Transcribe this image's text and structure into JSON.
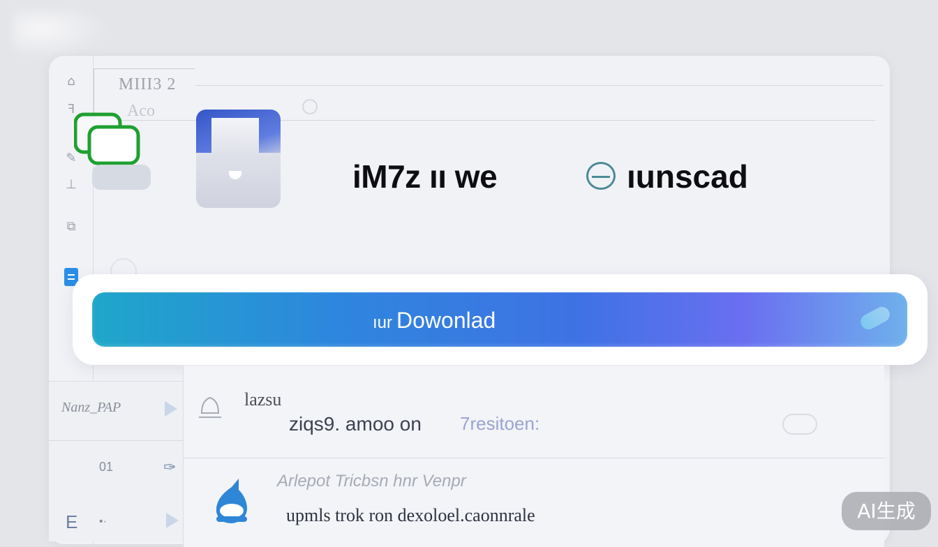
{
  "header": {
    "title": "MIII3 2",
    "subtitle": "Aco"
  },
  "apps": {
    "green_icon": "copy-windows-icon",
    "folder_icon": "folder-app-icon"
  },
  "headline": {
    "left": "iM7z ıı we",
    "right": "ıunscad"
  },
  "download_button": {
    "prefix": "ıur",
    "label": "Dowonlad"
  },
  "sidebar_list": {
    "item1": "Nanz_PAP",
    "item2": "01",
    "item3": "E"
  },
  "rows": [
    {
      "label": "lazsu",
      "primary": "ziqs9. amoo on",
      "secondary": "7resitoen:"
    },
    {
      "label": "Arlepot Tricbsn hnr Venpr",
      "primary": "upmls  trok  ron dexoloel.caonnrale"
    }
  ],
  "badge": "AI生成",
  "colors": {
    "accent": "#2e86de",
    "accent_end": "#6a6ff0",
    "green": "#1fa030",
    "folder_blue": "#3556c8"
  }
}
